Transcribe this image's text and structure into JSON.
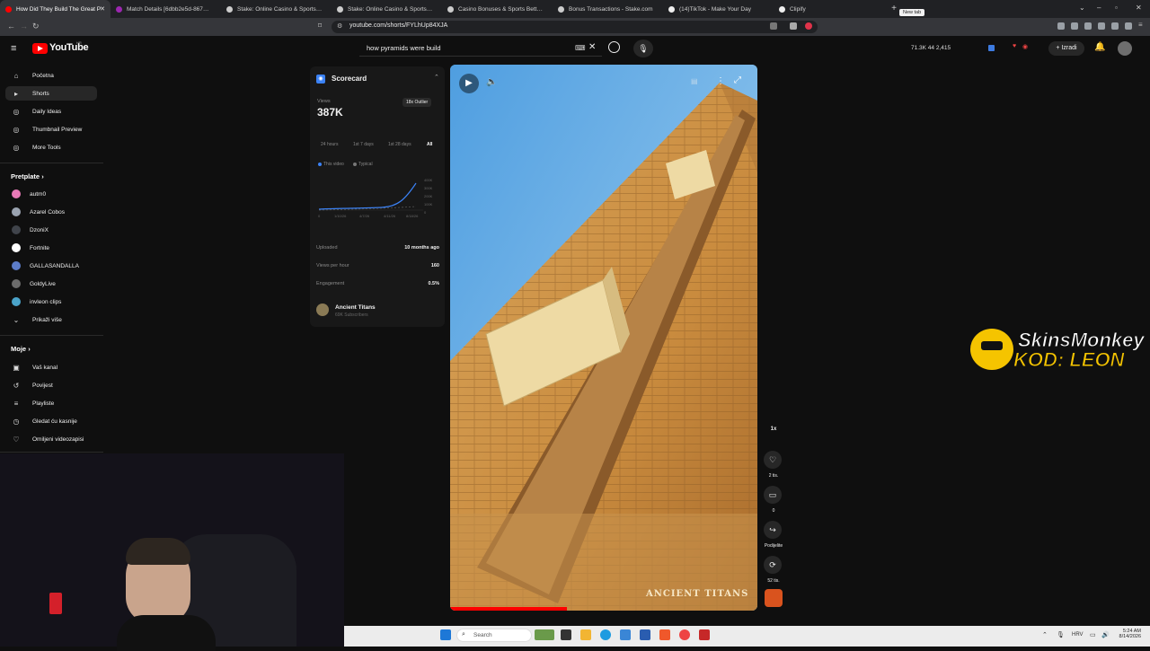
{
  "browser": {
    "tabs": [
      {
        "title": "How Did They Build The Great P",
        "fav": "#ff0000",
        "active": true
      },
      {
        "title": "Match Details [6dbb2e5d-8670-44dc",
        "fav": "#9c27b0",
        "active": false
      },
      {
        "title": "Stake: Online Casino & Sports Bettin",
        "fav": "#cccccc",
        "active": false
      },
      {
        "title": "Stake: Online Casino & Sports Bettin",
        "fav": "#cccccc",
        "active": false
      },
      {
        "title": "Casino Bonuses & Sports Betting Pro",
        "fav": "#cccccc",
        "active": false
      },
      {
        "title": "Bonus Transactions - Stake.com",
        "fav": "#cccccc",
        "active": false
      },
      {
        "title": "(14)TikTok - Make Your Day",
        "fav": "#eeeeee",
        "active": false
      },
      {
        "title": "Clipify",
        "fav": "#eeeeee",
        "active": false
      }
    ],
    "new_tab_tooltip": "New tab",
    "url": "youtube.com/shorts/FYLhUp84XJA"
  },
  "youtube": {
    "wordmark": "YouTube",
    "country": "HR",
    "search_query": "how pyramids were build",
    "header_stats": "71.3K  44  2,415",
    "create_label": "Izradi"
  },
  "sidebar": {
    "top_items": [
      {
        "label": "Početna",
        "icon": "home-icon",
        "glyph": "⌂"
      },
      {
        "label": "Shorts",
        "icon": "shorts-icon",
        "glyph": "▸",
        "active": true
      },
      {
        "label": "Daily Ideas",
        "icon": "ideas-icon",
        "glyph": "◎"
      },
      {
        "label": "Thumbnail Preview",
        "icon": "preview-icon",
        "glyph": "◎"
      },
      {
        "label": "More Tools",
        "icon": "tools-icon",
        "glyph": "◎"
      }
    ],
    "subs_heading": "Pretplate",
    "subscriptions": [
      {
        "label": "autm0",
        "color": "#e879b7"
      },
      {
        "label": "Azarel Cobos",
        "color": "#9aa3b0"
      },
      {
        "label": "DzoniX",
        "color": "#40444b"
      },
      {
        "label": "Fortnite",
        "color": "#ffffff"
      },
      {
        "label": "GALLASANDALLA",
        "color": "#5c7cc8"
      },
      {
        "label": "GoldyLive",
        "color": "#6b6b6b"
      },
      {
        "label": "invleon clips",
        "color": "#4aa3c9"
      },
      {
        "label": "Prikaži više",
        "color": ""
      }
    ],
    "you_heading": "Moje",
    "you_items": [
      {
        "label": "Vaš kanal",
        "glyph": "▣"
      },
      {
        "label": "Povijest",
        "glyph": "↺"
      },
      {
        "label": "Playliste",
        "glyph": "≡"
      },
      {
        "label": "Gledat ću kasnije",
        "glyph": "◷"
      },
      {
        "label": "Omiljeni videozapisi",
        "glyph": "♡"
      }
    ]
  },
  "scorecard": {
    "title": "Scorecard",
    "views_label": "Views",
    "views_value": "387K",
    "outlier_badge": "18x Outlier",
    "ranges": [
      "24 hours",
      "1st 7 days",
      "1st 28 days",
      "All"
    ],
    "legend_this": "This video",
    "legend_typical": "Typical",
    "y_ticks": [
      "400K",
      "300K",
      "200K",
      "100K",
      "0"
    ],
    "x_ticks": [
      "0",
      "1/10/26",
      "4/7/26",
      "4/11/26",
      "8/18/26"
    ],
    "uploaded_label": "Uploaded",
    "uploaded_value": "10 months ago",
    "vph_label": "Views per hour",
    "vph_value": "160",
    "engagement_label": "Engagement",
    "engagement_value": "0.5%",
    "channel_name": "Ancient Titans",
    "channel_subs": "69K Subscribers"
  },
  "video": {
    "watermark": "ANCIENT TITANS"
  },
  "actions": {
    "speed": "1x",
    "likes": "2 tis.",
    "comments": "0",
    "share": "Podijelite",
    "remix": "52 tis."
  },
  "overlay": {
    "brand": "SkinsMonkey",
    "code": "KOD: LEON"
  },
  "taskbar": {
    "search_placeholder": "Search",
    "lang": "HRV",
    "time": "5:24 AM",
    "date": "8/14/2026"
  }
}
